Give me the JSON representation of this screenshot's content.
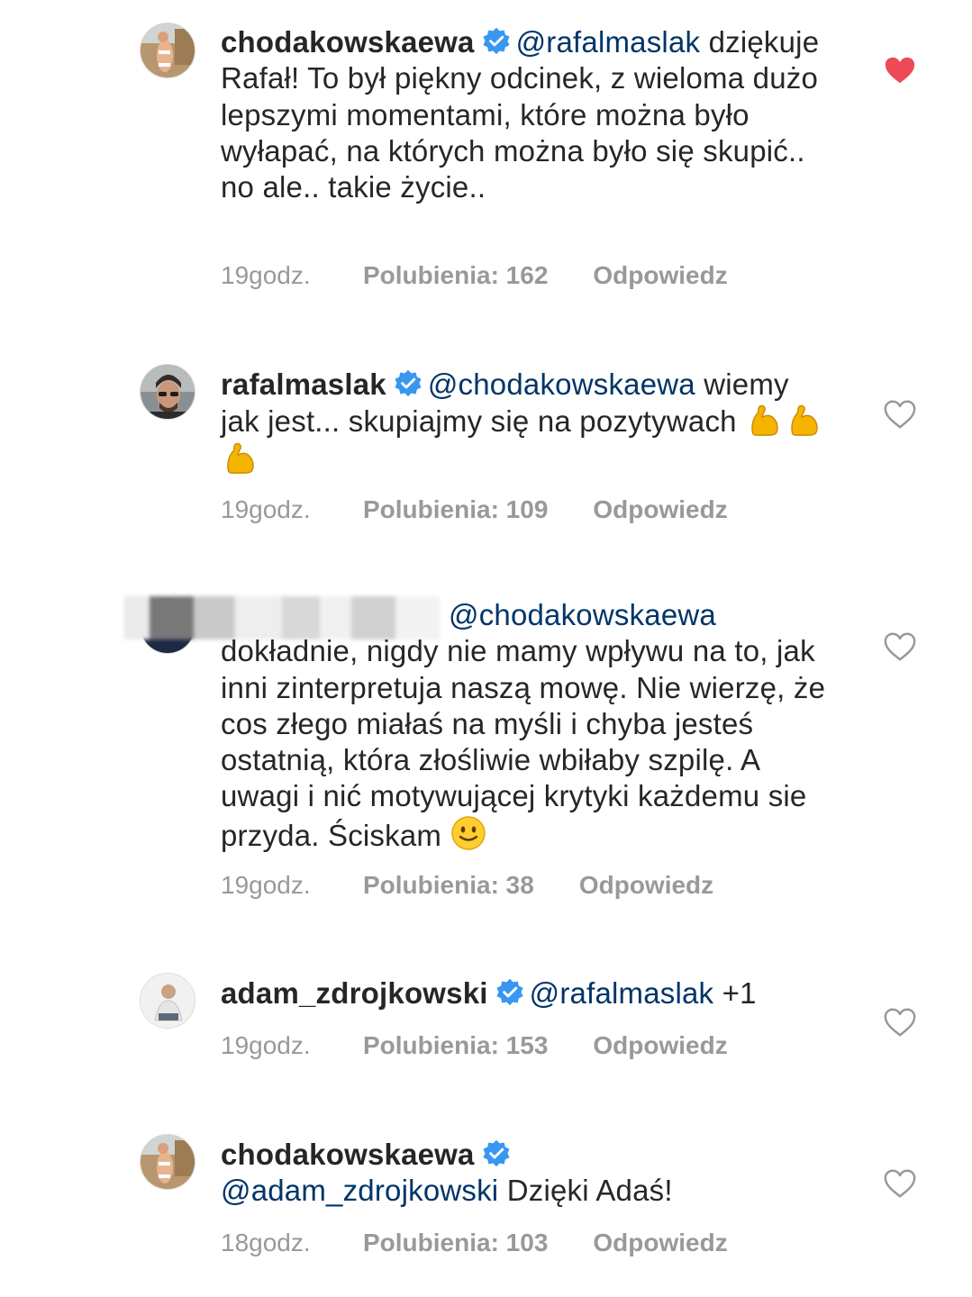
{
  "colors": {
    "text": "#262626",
    "mention": "#003569",
    "meta": "#999999",
    "verified": "#3897f0",
    "liked_heart": "#ed4956"
  },
  "comments": [
    {
      "username": "chodakowskaewa",
      "verified": true,
      "mention": "@rafalmaslak",
      "text": "dziękuje Rafał! To był piękny odcinek, z wieloma dużo lepszymi momentami, które można było wyłapać, na których można było się skupić.. no ale.. takie życie..",
      "time": "19godz.",
      "likes": "Polubienia: 162",
      "reply": "Odpowiedz",
      "liked": true
    },
    {
      "username": "rafalmaslak",
      "verified": true,
      "mention": "@chodakowskaewa",
      "text": "wiemy jak jest... skupiajmy się na pozytywach",
      "emoji": "flexed-biceps-emoji x3",
      "time": "19godz.",
      "likes": "Polubienia: 109",
      "reply": "Odpowiedz",
      "liked": false
    },
    {
      "username": "",
      "verified": false,
      "mention": "@chodakowskaewa",
      "text": "dokładnie, nigdy nie mamy wpływu na to, jak inni zinterpretuja naszą mowę. Nie wierzę, że cos złego miałaś na myśli i chyba jesteś ostatnią, która złośliwie wbiłaby szpilę. A uwagi i nić motywującej krytyki każdemu sie przyda. Ściskam",
      "emoji": "slightly-smiling-face-emoji",
      "time": "19godz.",
      "likes": "Polubienia: 38",
      "reply": "Odpowiedz",
      "liked": false
    },
    {
      "username": "adam_zdrojkowski",
      "verified": true,
      "mention": "@rafalmaslak",
      "text": "+1",
      "time": "19godz.",
      "likes": "Polubienia: 153",
      "reply": "Odpowiedz",
      "liked": false
    },
    {
      "username": "chodakowskaewa",
      "verified": true,
      "mention": "@adam_zdrojkowski",
      "text": "Dzięki Adaś!",
      "time": "18godz.",
      "likes": "Polubienia: 103",
      "reply": "Odpowiedz",
      "liked": false
    }
  ]
}
